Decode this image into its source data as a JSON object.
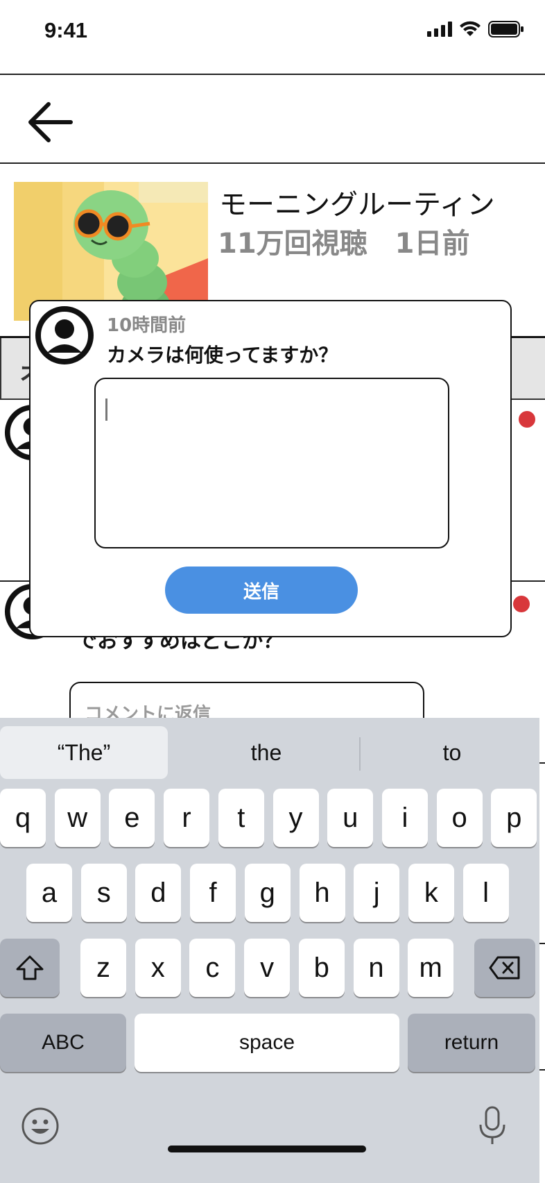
{
  "status_bar": {
    "time": "9:41"
  },
  "video": {
    "title": "モーニングルーティン",
    "views": "11万回視聴",
    "posted": "1日前"
  },
  "tabs": {
    "left_label_partial": "オ"
  },
  "comment_peek": {
    "body_partial": "でおすすめはどこか？"
  },
  "reply": {
    "placeholder": "コメントに返信"
  },
  "modal": {
    "time": "10時間前",
    "question": "カメラは何使ってますか？",
    "input_value": "",
    "send_label": "送信"
  },
  "keyboard": {
    "suggestions": [
      "“The”",
      "the",
      "to"
    ],
    "row1": [
      "q",
      "w",
      "e",
      "r",
      "t",
      "y",
      "u",
      "i",
      "o",
      "p"
    ],
    "row2": [
      "a",
      "s",
      "d",
      "f",
      "g",
      "h",
      "j",
      "k",
      "l"
    ],
    "row3": [
      "z",
      "x",
      "c",
      "v",
      "b",
      "n",
      "m"
    ],
    "abc_label": "ABC",
    "space_label": "space",
    "return_label": "return"
  },
  "colors": {
    "accent": "#4a90e2",
    "badge": "#d8373b",
    "keyboard_bg": "#d1d5db"
  },
  "icons": {
    "back": "arrow-left-icon",
    "avatar": "user-avatar-icon",
    "shift": "shift-icon",
    "delete": "backspace-icon",
    "emoji": "emoji-icon",
    "mic": "microphone-icon"
  }
}
